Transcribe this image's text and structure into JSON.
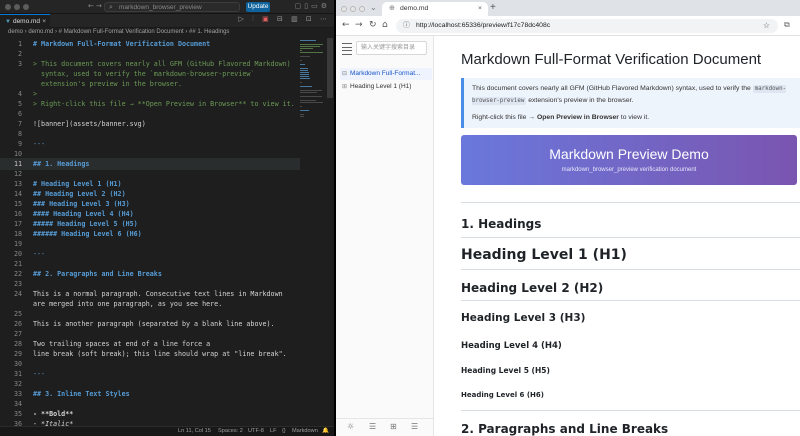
{
  "vscode": {
    "search_text": "markdown_browser_preview",
    "update_label": "Update",
    "tab": {
      "label": "demo.md",
      "icon": "markdown-icon"
    },
    "breadcrumb": "demo › demo.md › # Markdown Full-Format Verification Document › ## 1. Headings",
    "lines": [
      {
        "n": "1",
        "text": "# Markdown Full-Format Verification Document",
        "kind": "h"
      },
      {
        "n": "2",
        "text": "",
        "kind": "n"
      },
      {
        "n": "3",
        "text": "> This document covers nearly all GFM (GitHub Flavored Markdown)",
        "kind": "q"
      },
      {
        "n": "",
        "text": "  syntax, used to verify the `markdown-browser-preview`",
        "kind": "q"
      },
      {
        "n": "",
        "text": "  extension's preview in the browser.",
        "kind": "q"
      },
      {
        "n": "4",
        "text": ">",
        "kind": "q"
      },
      {
        "n": "5",
        "text": "> Right-click this file → **Open Preview in Browser** to view it.",
        "kind": "q"
      },
      {
        "n": "6",
        "text": "",
        "kind": "n"
      },
      {
        "n": "7",
        "text": "![banner](assets/banner.svg)",
        "kind": "n"
      },
      {
        "n": "8",
        "text": "",
        "kind": "n"
      },
      {
        "n": "9",
        "text": "---",
        "kind": "hr"
      },
      {
        "n": "10",
        "text": "",
        "kind": "n"
      },
      {
        "n": "11",
        "text": "## 1. Headings",
        "kind": "h"
      },
      {
        "n": "12",
        "text": "",
        "kind": "n"
      },
      {
        "n": "13",
        "text": "# Heading Level 1 (H1)",
        "kind": "h"
      },
      {
        "n": "14",
        "text": "## Heading Level 2 (H2)",
        "kind": "h"
      },
      {
        "n": "15",
        "text": "### Heading Level 3 (H3)",
        "kind": "h"
      },
      {
        "n": "16",
        "text": "#### Heading Level 4 (H4)",
        "kind": "h"
      },
      {
        "n": "17",
        "text": "##### Heading Level 5 (H5)",
        "kind": "h"
      },
      {
        "n": "18",
        "text": "###### Heading Level 6 (H6)",
        "kind": "h"
      },
      {
        "n": "19",
        "text": "",
        "kind": "n"
      },
      {
        "n": "20",
        "text": "---",
        "kind": "hr"
      },
      {
        "n": "21",
        "text": "",
        "kind": "n"
      },
      {
        "n": "22",
        "text": "## 2. Paragraphs and Line Breaks",
        "kind": "h"
      },
      {
        "n": "23",
        "text": "",
        "kind": "n"
      },
      {
        "n": "24",
        "text": "This is a normal paragraph. Consecutive text lines in Markdown",
        "kind": "n"
      },
      {
        "n": "",
        "text": "are merged into one paragraph, as you see here.",
        "kind": "n"
      },
      {
        "n": "25",
        "text": "",
        "kind": "n"
      },
      {
        "n": "26",
        "text": "This is another paragraph (separated by a blank line above).",
        "kind": "n"
      },
      {
        "n": "27",
        "text": "",
        "kind": "n"
      },
      {
        "n": "28",
        "text": "Two trailing spaces at end of a line force a",
        "kind": "n"
      },
      {
        "n": "29",
        "text": "line break (soft break); this line should wrap at \"line break\".",
        "kind": "n"
      },
      {
        "n": "30",
        "text": "",
        "kind": "n"
      },
      {
        "n": "31",
        "text": "---",
        "kind": "hr"
      },
      {
        "n": "32",
        "text": "",
        "kind": "n"
      },
      {
        "n": "33",
        "text": "## 3. Inline Text Styles",
        "kind": "h"
      },
      {
        "n": "34",
        "text": "",
        "kind": "n"
      },
      {
        "n": "35",
        "text": "- **Bold**",
        "kind": "b"
      },
      {
        "n": "36",
        "text": "- *Italic*",
        "kind": "i"
      }
    ],
    "status": {
      "position": "Ln 11, Col 15",
      "spaces": "Spaces: 2",
      "encoding": "UTF-8",
      "eol": "LF",
      "language": "Markdown"
    }
  },
  "browser": {
    "tab_title": "demo.md",
    "url": "http://localhost:65336/preview/f17c78dc408c",
    "toc": {
      "search_placeholder": "输入关键字搜索目录",
      "items": [
        {
          "label": "Markdown Full-Format...",
          "active": true,
          "toggle": "⊟"
        },
        {
          "label": "Heading Level 1 (H1)",
          "active": false,
          "toggle": "⊞"
        }
      ]
    },
    "preview": {
      "title": "Markdown Full-Format Verification Document",
      "quote_line1": "This document covers nearly all GFM (GitHub Flavored Markdown) syntax, used to verify the",
      "quote_code": "markdown-browser-preview",
      "quote_line2_rest": " extension's preview in the browser.",
      "quote_p2_prefix": "Right-click this file → ",
      "quote_p2_bold": "Open Preview in Browser",
      "quote_p2_suffix": " to view it.",
      "banner_title": "Markdown Preview Demo",
      "banner_subtitle": "markdown_browser_preview verification document",
      "headings": [
        {
          "text": "1. Headings",
          "level": "h2"
        },
        {
          "text": "Heading Level 1 (H1)",
          "level": "h1"
        },
        {
          "text": "Heading Level 2 (H2)",
          "level": "h2"
        },
        {
          "text": "Heading Level 3 (H3)",
          "level": "h3"
        },
        {
          "text": "Heading Level 4 (H4)",
          "level": "h4"
        },
        {
          "text": "Heading Level 5 (H5)",
          "level": "h5"
        },
        {
          "text": "Heading Level 6 (H6)",
          "level": "h6"
        },
        {
          "text": "2. Paragraphs and Line Breaks",
          "level": "h2"
        }
      ]
    }
  },
  "colors": {
    "vscode_bg": "#1e1e1e",
    "heading_token": "#569cd6",
    "quote_token": "#6a9955",
    "accent_blue": "#0078d4",
    "toc_active": "#1a55c7",
    "banner_start": "#6a78dc",
    "banner_end": "#7a55b0"
  }
}
